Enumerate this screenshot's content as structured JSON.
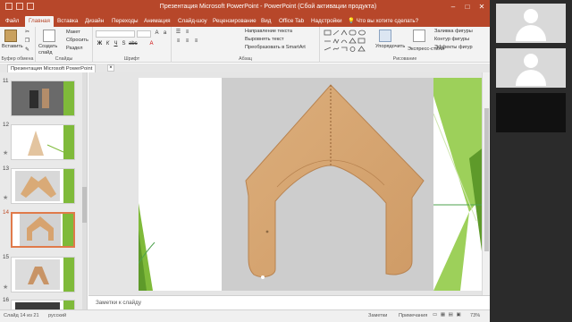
{
  "window": {
    "title": "Презентация Microsoft PowerPoint - PowerPoint (Сбой активации продукта)",
    "minimize": "–",
    "maximize": "□",
    "close": "✕"
  },
  "tabs": [
    {
      "label": "Файл"
    },
    {
      "label": "Главная"
    },
    {
      "label": "Вставка"
    },
    {
      "label": "Дизайн"
    },
    {
      "label": "Переходы"
    },
    {
      "label": "Анимация"
    },
    {
      "label": "Слайд-шоу"
    },
    {
      "label": "Рецензирование"
    },
    {
      "label": "Вид"
    },
    {
      "label": "Office Tab"
    },
    {
      "label": "Надстройки"
    }
  ],
  "tell_me": "Что вы хотите сделать?",
  "ribbon": {
    "clipboard": {
      "paste": "Вставить",
      "group": "Буфер обмена"
    },
    "slides": {
      "new_slide": "Создать слайд",
      "layout": "Макет",
      "reset": "Сбросить",
      "section": "Раздел",
      "group": "Слайды"
    },
    "font": {
      "group": "Шрифт"
    },
    "paragraph": {
      "text_direction": "Направление текста",
      "align_text": "Выровнять текст",
      "smartart": "Преобразовать в SmartArt",
      "group": "Абзац"
    },
    "drawing": {
      "arrange": "Упорядочить",
      "quick_styles": "Экспресс-стили",
      "fill": "Заливка фигуры",
      "outline": "Контур фигуры",
      "effects": "Эффекты фигур",
      "group": "Рисование"
    }
  },
  "pane": {
    "title": "Презентация Microsoft PowerPoint",
    "close": "×"
  },
  "thumbnails": [
    {
      "num": "11"
    },
    {
      "num": "12"
    },
    {
      "num": "13"
    },
    {
      "num": "14"
    },
    {
      "num": "15"
    },
    {
      "num": "16"
    }
  ],
  "notes_placeholder": "Заметки к слайду",
  "status": {
    "slide_info": "Слайд 14 из 21",
    "language": "русский",
    "notes": "Заметки",
    "comments": "Примечания",
    "zoom": "73%"
  },
  "colors": {
    "accent": "#b7472a",
    "slide_green": "#7fba3a",
    "garment": "#d7a36f"
  }
}
